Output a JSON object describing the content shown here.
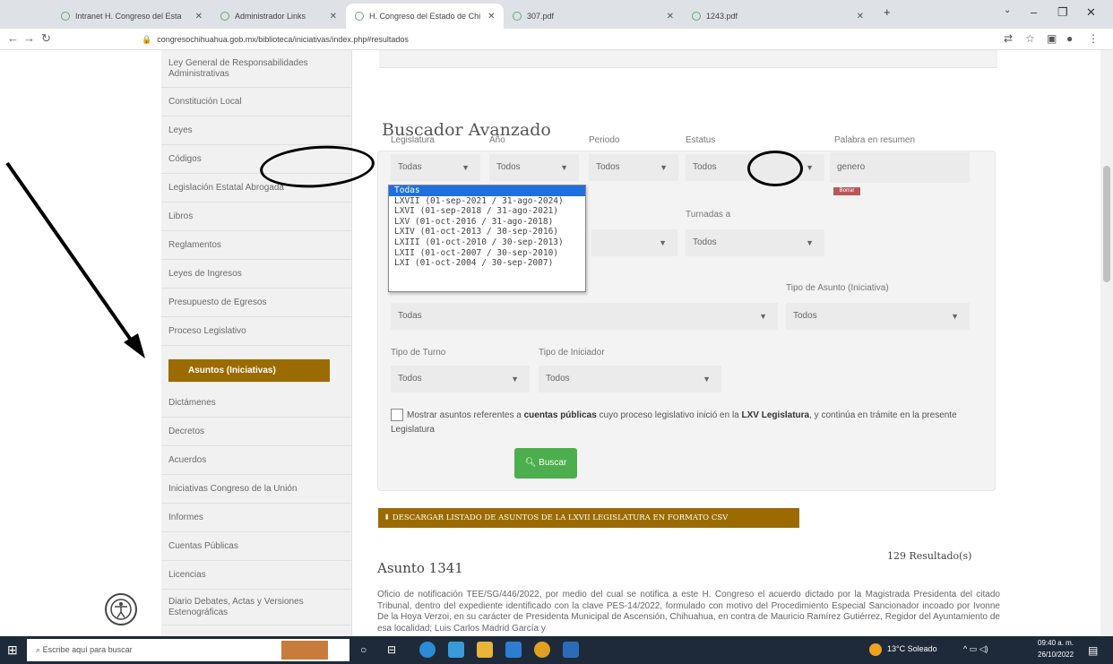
{
  "browser": {
    "tabs": [
      {
        "label": "Intranet H. Congreso del Esta"
      },
      {
        "label": "Administrador Links"
      },
      {
        "label": "H. Congreso del Estado de Chi"
      },
      {
        "label": "307.pdf"
      },
      {
        "label": "1243.pdf"
      }
    ],
    "url": "congresochihuahua.gob.mx/biblioteca/iniciativas/index.php#resultados"
  },
  "sidebar": {
    "items": [
      {
        "label": "Ley General de Responsabilidades Administrativas"
      },
      {
        "label": "Constitución Local"
      },
      {
        "label": "Leyes"
      },
      {
        "label": "Códigos"
      },
      {
        "label": "Legislación Estatal Abrogada"
      },
      {
        "label": "Libros"
      },
      {
        "label": "Reglamentos"
      },
      {
        "label": "Leyes de Ingresos"
      },
      {
        "label": "Presupuesto de Egresos"
      },
      {
        "label": "Proceso Legislativo"
      },
      {
        "label": "Asuntos (Iniciativas)"
      },
      {
        "label": "Dictámenes"
      },
      {
        "label": "Decretos"
      },
      {
        "label": "Acuerdos"
      },
      {
        "label": "Iniciativas Congreso de la Unión"
      },
      {
        "label": "Informes"
      },
      {
        "label": "Cuentas Públicas"
      },
      {
        "label": "Licencias"
      },
      {
        "label": "Diario Debates, Actas y Versiones Estenográficas"
      }
    ]
  },
  "search": {
    "title": "Buscador Avanzado",
    "labels": {
      "legislatura": "Legislatura",
      "anio": "Año",
      "periodo": "Periodo",
      "estatus": "Estatus",
      "palabra": "Palabra en resumen",
      "turnadas": "Turnadas a",
      "tipo_asunto": "Tipo de Asunto (Iniciativa)",
      "tipo_turno": "Tipo de Turno",
      "tipo_iniciador": "Tipo de Iniciador"
    },
    "values": {
      "legislatura": "Todas",
      "anio": "Todos",
      "periodo": "Todos",
      "estatus": "Todos",
      "palabra": "genero",
      "turnadas": "Todos",
      "comision": "Todas",
      "tipo_asunto": "Todos",
      "tipo_turno": "Todos",
      "tipo_iniciador": "Todos"
    },
    "palabra_badge": "Borrar",
    "dropdown_options": [
      "Todas",
      "LXVII (01-sep-2021 / 31-ago-2024)",
      "LXVI (01-sep-2018 / 31-ago-2021)",
      "LXV (01-oct-2016 / 31-ago-2018)",
      "LXIV (01-oct-2013 / 30-sep-2016)",
      "LXIII (01-oct-2010 / 30-sep-2013)",
      "LXII (01-oct-2007 / 30-sep-2010)",
      "LXI (01-oct-2004 / 30-sep-2007)"
    ],
    "checkbox_text_1": "Mostrar asuntos referentes a",
    "checkbox_bold_1": "cuentas públicas",
    "checkbox_text_2": "cuyo proceso legislativo inició en la",
    "checkbox_bold_2": "LXV Legislatura",
    "checkbox_text_3": ", y continúa en trámite en la presente Legislatura",
    "button": "Buscar"
  },
  "download": {
    "label": "DESCARGAR LISTADO DE ASUNTOS DE LA LXVII LEGISLATURA EN FORMATO CSV"
  },
  "results": {
    "count": "129 Resultado(s)",
    "item_title": "Asunto 1341",
    "item_desc": "Oficio de notificación TEE/SG/446/2022, por medio del cual se notifica a este H. Congreso el acuerdo dictado por la Magistrada Presidenta del citado Tribunal, dentro del expediente identificado con la clave PES-14/2022, formulado con motivo del Procedimiento Especial Sancionador incoado por Ivonne De la Hoya Verzoi, en su carácter de Presidenta Municipal de Ascensión, Chihuahua, en contra de Mauricio Ramírez Gutiérrez, Regidor del Ayuntamiento de esa localidad; Luis Carlos Madrid García y"
  },
  "taskbar": {
    "search_placeholder": "Escribe aquí para buscar",
    "weather": "13°C Soleado",
    "time": "09:40 a. m.",
    "date": "26/10/2022"
  },
  "colors": {
    "accent_gold": "#9b6b00",
    "button_green": "#4cae4c",
    "dropdown_highlight": "#1e6fe0"
  }
}
